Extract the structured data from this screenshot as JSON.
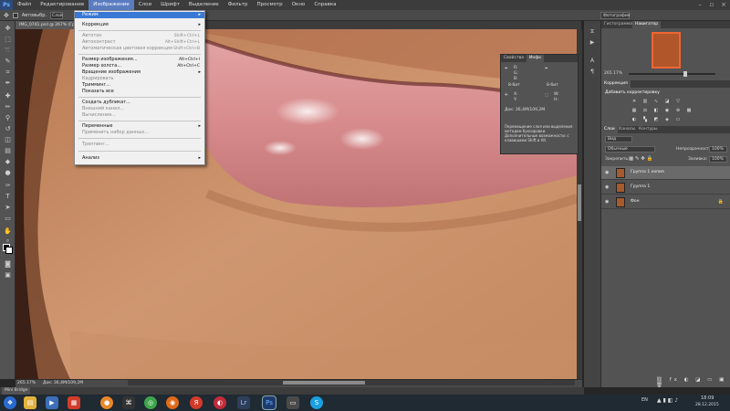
{
  "app": {
    "logo": "Ps",
    "menu": [
      "Файл",
      "Редактирование",
      "Изображение",
      "Слои",
      "Шрифт",
      "Выделение",
      "Фильтр",
      "Просмотр",
      "Окно",
      "Справка"
    ],
    "active_menu_index": 2
  },
  "options_bar": {
    "auto_select_label": "Автовыбр.",
    "auto_select_value": "Слой",
    "workspace": "Фотография"
  },
  "document": {
    "tab_label": "IMG_0741.psd @ 267% (Гр...",
    "zoom": "265.17%",
    "doc_size": "Док: 36,4М/109,2М"
  },
  "mini_bridge_label": "Mini Bridge",
  "image_menu": {
    "items": [
      {
        "label": "Режим",
        "shortcut": "",
        "submenu": true,
        "disabled": false,
        "highlighted": true
      },
      {
        "label": "Коррекция",
        "shortcut": "",
        "submenu": true,
        "disabled": false,
        "highlighted": false
      },
      {
        "label": "Автотон",
        "shortcut": "Shift+Ctrl+L",
        "submenu": false,
        "disabled": true,
        "highlighted": false
      },
      {
        "label": "Автоконтраст",
        "shortcut": "Alt+Shift+Ctrl+L",
        "submenu": false,
        "disabled": true,
        "highlighted": false
      },
      {
        "label": "Автоматическая цветовая коррекция",
        "shortcut": "Shift+Ctrl+B",
        "submenu": false,
        "disabled": true,
        "highlighted": false
      },
      {
        "label": "Размер изображения...",
        "shortcut": "Alt+Ctrl+I",
        "submenu": false,
        "disabled": false,
        "highlighted": false
      },
      {
        "label": "Размер холста...",
        "shortcut": "Alt+Ctrl+C",
        "submenu": false,
        "disabled": false,
        "highlighted": false
      },
      {
        "label": "Вращение изображения",
        "shortcut": "",
        "submenu": true,
        "disabled": false,
        "highlighted": false
      },
      {
        "label": "Кадрировать",
        "shortcut": "",
        "submenu": false,
        "disabled": true,
        "highlighted": false
      },
      {
        "label": "Тримминг...",
        "shortcut": "",
        "submenu": false,
        "disabled": false,
        "highlighted": false
      },
      {
        "label": "Показать все",
        "shortcut": "",
        "submenu": false,
        "disabled": false,
        "highlighted": false
      },
      {
        "label": "Создать дубликат...",
        "shortcut": "",
        "submenu": false,
        "disabled": false,
        "highlighted": false
      },
      {
        "label": "Внешний канал...",
        "shortcut": "",
        "submenu": false,
        "disabled": true,
        "highlighted": false
      },
      {
        "label": "Вычисления...",
        "shortcut": "",
        "submenu": false,
        "disabled": true,
        "highlighted": false
      },
      {
        "label": "Переменные",
        "shortcut": "",
        "submenu": true,
        "disabled": false,
        "highlighted": false
      },
      {
        "label": "Применить набор данных...",
        "shortcut": "",
        "submenu": false,
        "disabled": true,
        "highlighted": false
      },
      {
        "label": "Треппинг...",
        "shortcut": "",
        "submenu": false,
        "disabled": true,
        "highlighted": false
      },
      {
        "label": "Анализ",
        "shortcut": "",
        "submenu": true,
        "disabled": false,
        "highlighted": false
      }
    ]
  },
  "info_panel": {
    "tabs": [
      "Свойства",
      "Инфо"
    ],
    "r1": "R:",
    "g1": "G:",
    "b1": "B:",
    "bit1": "8-бит",
    "bit2": "8-бит",
    "x": "X:",
    "y": "Y:",
    "w": "W:",
    "h": "H:",
    "doc": "Док: 36,4М/109,2М",
    "description": "Перемещение слоя или выделения методом буксировки. Дополнительные возможности: с клавишами Shift и Alt."
  },
  "right_panel": {
    "top_tabs": [
      "Гистограмма",
      "Навигатор"
    ],
    "nav_zoom": "265.17%",
    "adjust_tab": "Коррекция",
    "adjust_title": "Добавить корректировку",
    "layers_tabs": [
      "Слои",
      "Каналы",
      "Контуры"
    ],
    "kind_label": "Вид",
    "blend_mode": "Обычные",
    "opacity_label": "Непрозрачность:",
    "opacity": "100%",
    "lock_label": "Закрепить:",
    "fill_label": "Заливка:",
    "fill": "100%",
    "layers": [
      {
        "name": "Группа 1 копия",
        "selected": true,
        "locked": false
      },
      {
        "name": "Группа 1",
        "selected": false,
        "locked": false
      },
      {
        "name": "Фон",
        "selected": false,
        "locked": true
      }
    ]
  },
  "taskbar": {
    "lang": "EN",
    "time": "18:09",
    "date": "28.12.2015",
    "apps": [
      "Start",
      "Explorer",
      "Media",
      "Sandbox",
      "Chrome",
      "Firefox",
      "Yandex",
      "Blender",
      "Lr",
      "Ps",
      "Notebook",
      "Skype"
    ]
  }
}
